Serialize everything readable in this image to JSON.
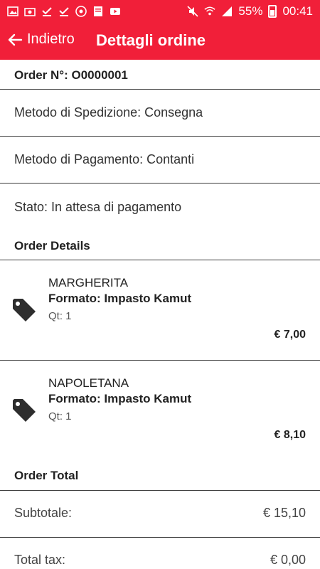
{
  "status_bar": {
    "battery": "55%",
    "time": "00:41"
  },
  "header": {
    "back_label": "Indietro",
    "title": "Dettagli ordine"
  },
  "order": {
    "number": "Order N°: O0000001",
    "shipping": "Metodo di Spedizione: Consegna",
    "payment": "Metodo di Pagamento: Contanti",
    "status": "Stato: In attesa di pagamento"
  },
  "details_heading": "Order Details",
  "items": [
    {
      "name": "MARGHERITA",
      "format": "Formato: Impasto Kamut",
      "qty": "Qt: 1",
      "price": "€ 7,00"
    },
    {
      "name": "NAPOLETANA",
      "format": "Formato: Impasto Kamut",
      "qty": "Qt: 1",
      "price": "€ 8,10"
    }
  ],
  "total_heading": "Order Total",
  "totals": [
    {
      "label": "Subtotale:",
      "value": "€ 15,10"
    },
    {
      "label": "Total tax:",
      "value": "€ 0,00"
    }
  ],
  "colors": {
    "accent": "#f11f39"
  }
}
